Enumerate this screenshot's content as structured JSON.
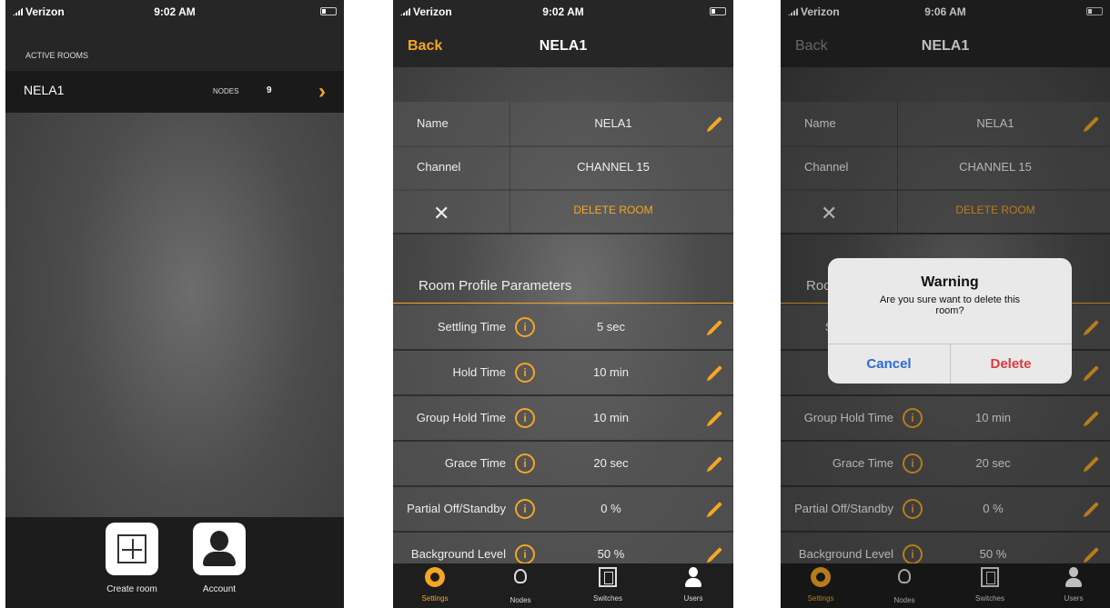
{
  "status_bar": {
    "carrier": "Verizon",
    "phone1_time": "9:02 AM",
    "phone2_time": "9:02 AM",
    "phone3_time": "9:06 AM"
  },
  "rooms_screen": {
    "section_label": "ACTIVE ROOMS",
    "room": {
      "name": "NELA1",
      "nodes_label": "NODES",
      "nodes_count": "9"
    },
    "actions": {
      "create_room": "Create room",
      "account": "Account"
    }
  },
  "room_detail": {
    "back": "Back",
    "title": "NELA1",
    "name_label": "Name",
    "name_value": "NELA1",
    "channel_label": "Channel",
    "channel_value": "CHANNEL 15",
    "delete_label": "DELETE ROOM",
    "section_title": "Room Profile Parameters",
    "params": [
      {
        "label": "Settling Time",
        "value": "5 sec"
      },
      {
        "label": "Hold Time",
        "value": "10 min"
      },
      {
        "label": "Group Hold Time",
        "value": "10 min"
      },
      {
        "label": "Grace Time",
        "value": "20 sec"
      },
      {
        "label": "Partial Off/Standby",
        "value": "0 %"
      },
      {
        "label": "Background Level",
        "value": "50 %"
      }
    ],
    "tabs": [
      "Settings",
      "Nodes",
      "Switches",
      "Users"
    ],
    "info_glyph": "i"
  },
  "alert": {
    "title": "Warning",
    "message": "Are you sure want to delete this room?",
    "cancel": "Cancel",
    "delete": "Delete"
  },
  "colors": {
    "accent": "#f5a623",
    "cancel": "#2d6bd6",
    "delete": "#e0383e"
  }
}
